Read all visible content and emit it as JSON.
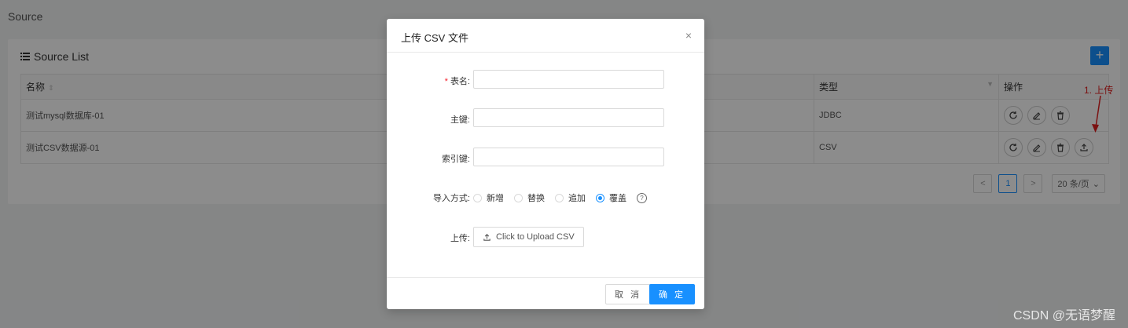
{
  "page": {
    "title": "Source"
  },
  "card": {
    "title": "Source List",
    "add_label": "+"
  },
  "table": {
    "headers": {
      "name": "名称",
      "type": "类型",
      "ops": "操作"
    },
    "rows": [
      {
        "name": "测试mysql数据库-01",
        "type": "JDBC"
      },
      {
        "name": "测试CSV数据源-01",
        "type": "CSV"
      }
    ]
  },
  "pagination": {
    "prev": "<",
    "current": "1",
    "next": ">",
    "page_size": "20 条/页"
  },
  "annotation": {
    "text": "1. 上传"
  },
  "modal": {
    "title": "上传 CSV 文件",
    "close": "×",
    "fields": {
      "table_name_label": "表名:",
      "table_name_value": "",
      "primary_key_label": "主键:",
      "primary_key_value": "",
      "index_key_label": "索引键:",
      "index_key_value": "",
      "import_mode_label": "导入方式:",
      "import_modes": [
        "新增",
        "替换",
        "追加",
        "覆盖"
      ],
      "import_mode_selected": "覆盖",
      "help": "?",
      "upload_label": "上传:",
      "upload_button": "Click to Upload CSV"
    },
    "footer": {
      "cancel": "取 消",
      "ok": "确 定"
    }
  },
  "watermark": "CSDN @无语梦醒",
  "colors": {
    "primary": "#1890ff",
    "required": "#f5222d",
    "annotation": "#e02020",
    "mask": "rgba(0,0,0,0.45)"
  }
}
